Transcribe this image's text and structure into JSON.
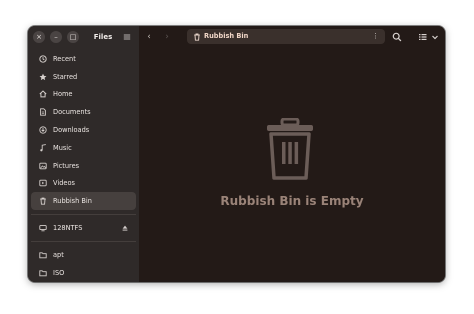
{
  "window": {
    "controls": {
      "close": "×",
      "minimize": "–",
      "maximize": "□"
    },
    "app_title": "Files",
    "menu_icon": "hamburger-menu-icon"
  },
  "sidebar": {
    "items": [
      {
        "label": "Recent",
        "icon": "clock-icon"
      },
      {
        "label": "Starred",
        "icon": "star-icon"
      },
      {
        "label": "Home",
        "icon": "home-icon"
      },
      {
        "label": "Documents",
        "icon": "document-icon"
      },
      {
        "label": "Downloads",
        "icon": "download-icon"
      },
      {
        "label": "Music",
        "icon": "music-icon"
      },
      {
        "label": "Pictures",
        "icon": "picture-icon"
      },
      {
        "label": "Videos",
        "icon": "video-icon"
      },
      {
        "label": "Rubbish Bin",
        "icon": "trash-icon",
        "active": true
      }
    ],
    "devices": [
      {
        "label": "128NTFS",
        "icon": "drive-icon",
        "eject_icon": "eject-icon"
      }
    ],
    "bookmarks": [
      {
        "label": "apt",
        "icon": "folder-icon"
      },
      {
        "label": "ISO",
        "icon": "folder-icon"
      }
    ]
  },
  "toolbar": {
    "back": "‹",
    "forward": "›",
    "path": {
      "label": "Rubbish Bin",
      "icon": "trash-icon",
      "menu": "⋮"
    },
    "search_icon": "search-icon",
    "view_icon": "list-view-icon",
    "view_chevron": "chevron-down-icon"
  },
  "main": {
    "empty_icon": "trash-bin-icon",
    "empty_text": "Rubbish Bin is Empty"
  },
  "colors": {
    "sidebar_bg": "#2f2a29",
    "main_bg": "#231a17",
    "active_item": "#46403e",
    "path_bg": "#3a302c",
    "empty_icon": "#6b5d58",
    "empty_text": "#9a8378"
  }
}
